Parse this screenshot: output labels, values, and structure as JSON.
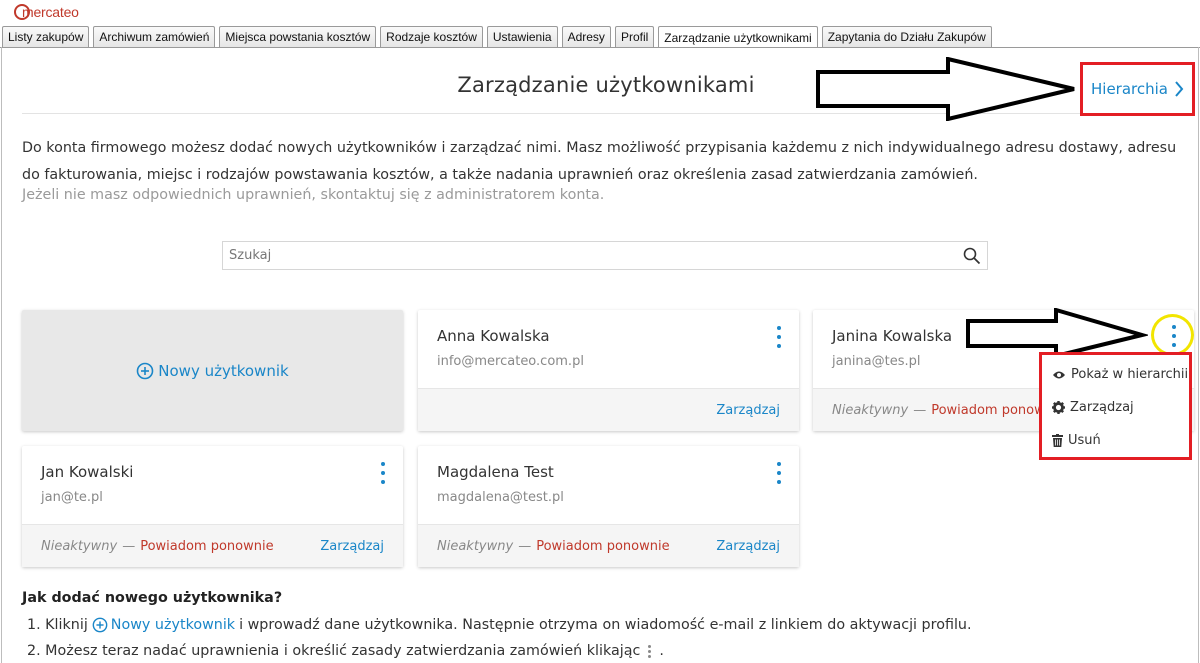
{
  "logo": {
    "text": "mercateo"
  },
  "tabs": [
    {
      "label": "Listy zakupów",
      "active": false
    },
    {
      "label": "Archiwum zamówień",
      "active": false
    },
    {
      "label": "Miejsca powstania kosztów",
      "active": false
    },
    {
      "label": "Rodzaje kosztów",
      "active": false
    },
    {
      "label": "Ustawienia",
      "active": false
    },
    {
      "label": "Adresy",
      "active": false
    },
    {
      "label": "Profil",
      "active": false
    },
    {
      "label": "Zarządzanie użytkownikami",
      "active": true
    },
    {
      "label": "Zapytania do Działu Zakupów",
      "active": false
    }
  ],
  "header": {
    "title": "Zarządzanie użytkownikami",
    "hierarchy_link": "Hierarchia"
  },
  "intro": {
    "text": "Do konta firmowego możesz dodać nowych użytkowników i zarządzać nimi. Masz możliwość przypisania każdemu z nich indywidualnego adresu dostawy, adresu do fakturowania, miejsc i rodzajów powstawania kosztów, a także nadania uprawnień oraz określenia zasad zatwierdzania zamówień.",
    "muted": "Jeżeli nie masz odpowiednich uprawnień, skontaktuj się z administratorem konta."
  },
  "search": {
    "placeholder": "Szukaj"
  },
  "new_user": {
    "label": "Nowy użytkownik"
  },
  "users": [
    {
      "name": "Anna Kowalska",
      "email": "info@mercateo.com.pl",
      "status": "",
      "resend": "",
      "manage": "Zarządzaj"
    },
    {
      "name": "Janina Kowalska",
      "email": "janina@tes.pl",
      "status": "Nieaktywny",
      "resend": "Powiadom ponownie",
      "manage": ""
    },
    {
      "name": "Jan Kowalski",
      "email": "jan@te.pl",
      "status": "Nieaktywny",
      "resend": "Powiadom ponownie",
      "manage": "Zarządzaj"
    },
    {
      "name": "Magdalena Test",
      "email": "magdalena@test.pl",
      "status": "Nieaktywny",
      "resend": "Powiadom ponownie",
      "manage": "Zarządzaj"
    }
  ],
  "status_separator": "—",
  "menu": {
    "items": [
      {
        "label": "Pokaż w hierarchii",
        "icon": "eye-icon"
      },
      {
        "label": "Zarządzaj",
        "icon": "gear-icon"
      },
      {
        "label": "Usuń",
        "icon": "trash-icon"
      }
    ]
  },
  "howto": {
    "title": "Jak dodać nowego użytkownika?",
    "step1_prefix": "1. Kliknij",
    "step1_link": "Nowy użytkownik",
    "step1_suffix": "i wprowadź dane użytkownika. Następnie otrzyma on wiadomość e-mail z linkiem do aktywacji profilu.",
    "step2_prefix": "2. Możesz teraz nadać uprawnienia i określić zasady zatwierdzania zamówień klikając",
    "step2_suffix": "."
  },
  "colors": {
    "link": "#1a86c8",
    "danger": "#c0392b",
    "annotation_red": "#e31e24",
    "annotation_yellow": "#f2e500"
  }
}
